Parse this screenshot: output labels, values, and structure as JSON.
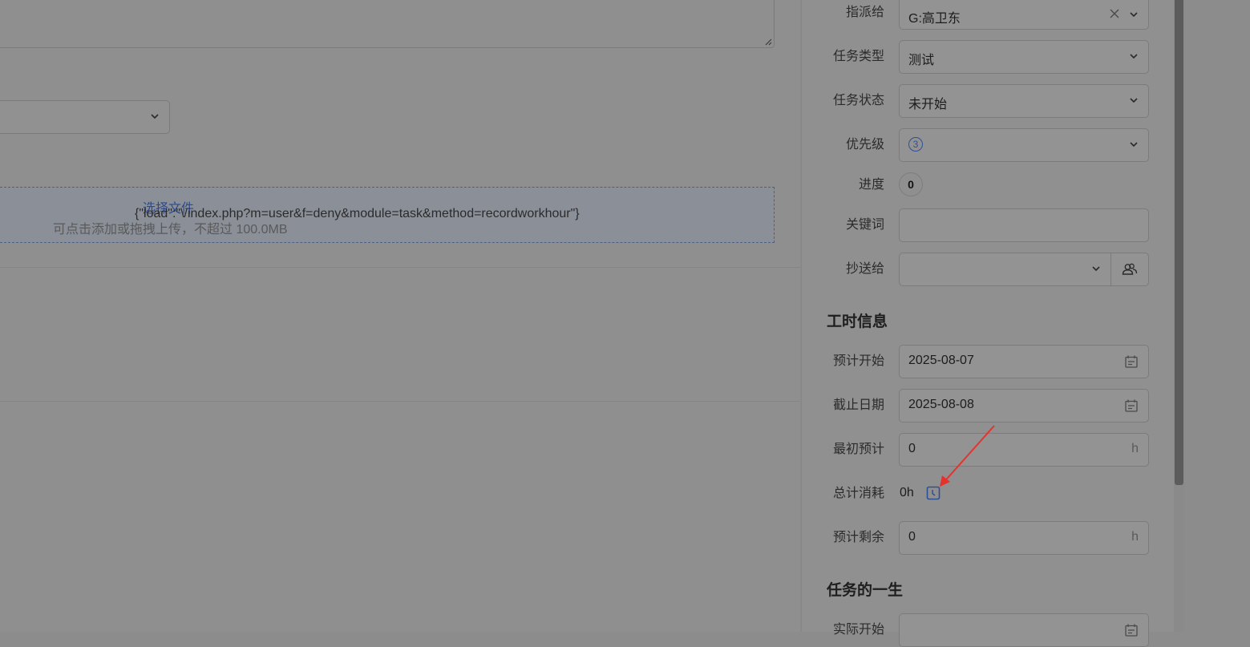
{
  "upload": {
    "select_file": "选择文件",
    "load_json": "{\"load\":\"\\/index.php?m=user&f=deny&module=task&method=recordworkhour\"}",
    "hint": "可点击添加或拖拽上传，不超过 100.0MB"
  },
  "form": {
    "assign_label": "指派给",
    "assign_value": "G:高卫东",
    "type_label": "任务类型",
    "type_value": "测试",
    "status_label": "任务状态",
    "status_value": "未开始",
    "priority_label": "优先级",
    "priority_value": "3",
    "progress_label": "进度",
    "progress_value": "0",
    "keywords_label": "关键词",
    "keywords_value": "",
    "cc_label": "抄送给",
    "cc_value": ""
  },
  "workhours": {
    "title": "工时信息",
    "est_start_label": "预计开始",
    "est_start_value": "2025-08-07",
    "deadline_label": "截止日期",
    "deadline_value": "2025-08-08",
    "initial_est_label": "最初预计",
    "initial_est_value": "0",
    "unit": "h",
    "consumed_label": "总计消耗",
    "consumed_value": "0h",
    "remaining_label": "预计剩余",
    "remaining_value": "0"
  },
  "life": {
    "title": "任务的一生",
    "real_start_label": "实际开始"
  },
  "colors": {
    "overlay_bg": "#8f8f8f",
    "accent": "#2f4f95",
    "annotation_arrow": "#e5322d"
  }
}
